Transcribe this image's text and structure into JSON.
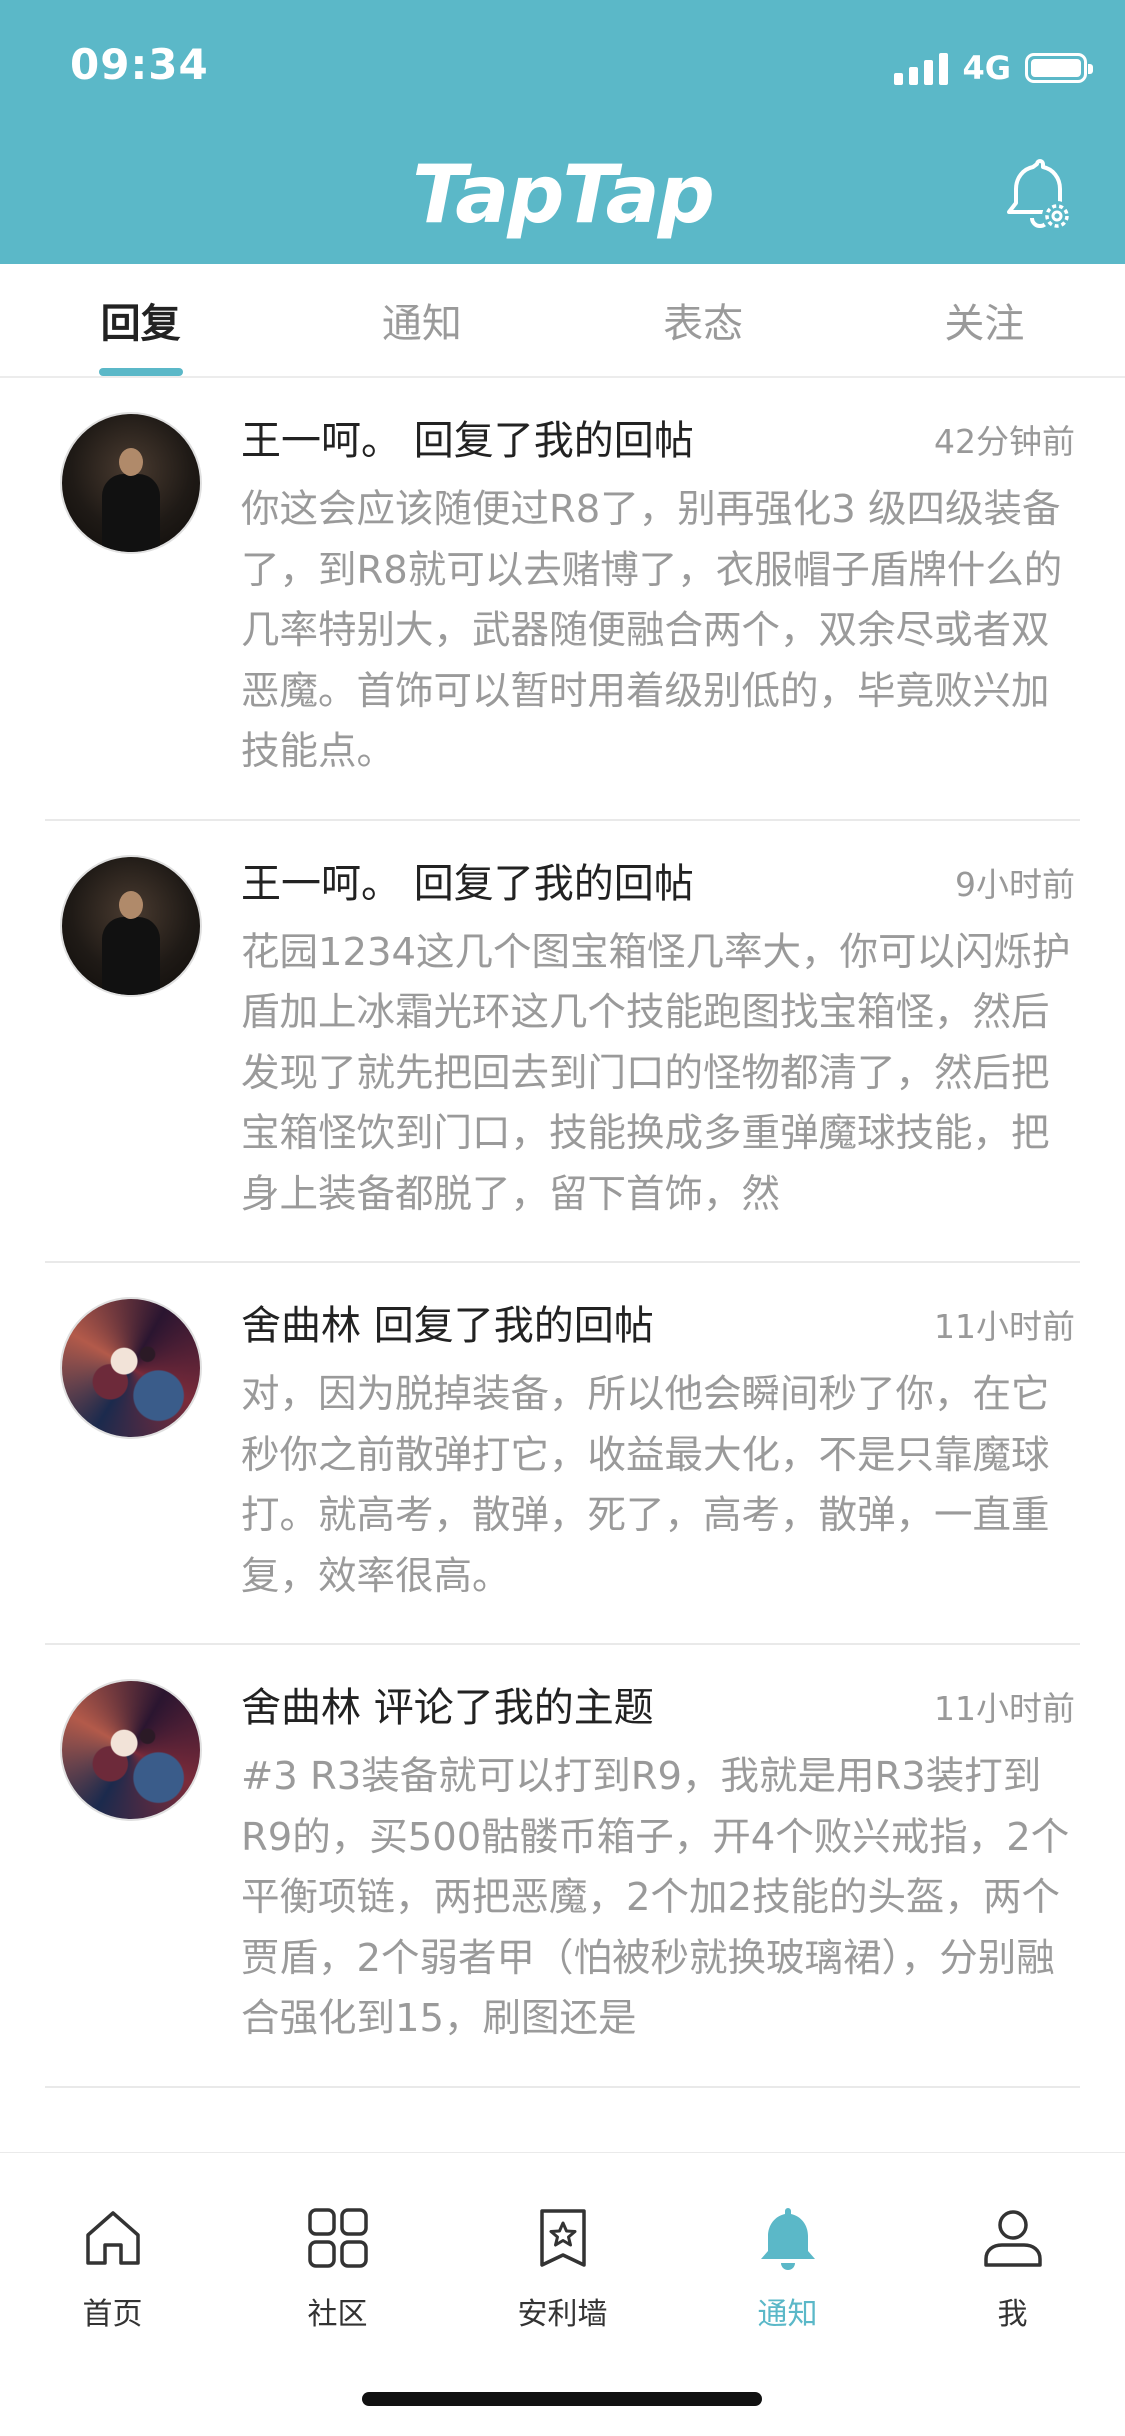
{
  "status_bar": {
    "time": "09:34",
    "network": "4G"
  },
  "header": {
    "app_title": "TapTap",
    "settings_icon": "bell-gear-icon"
  },
  "tabs": [
    {
      "label": "回复",
      "active": true
    },
    {
      "label": "通知",
      "active": false
    },
    {
      "label": "表态",
      "active": false
    },
    {
      "label": "关注",
      "active": false
    }
  ],
  "notifications": [
    {
      "title": "王一呵。 回复了我的回帖",
      "time": "42分钟前",
      "body": "你这会应该随便过R8了，别再强化3 级四级装备了，到R8就可以去赌博了，衣服帽子盾牌什么的几率特别大，武器随便融合两个，双余尽或者双恶魔。首饰可以暂时用着级别低的，毕竟败兴加技能点。"
    },
    {
      "title": "王一呵。 回复了我的回帖",
      "time": "9小时前",
      "body": "花园1234这几个图宝箱怪几率大，你可以闪烁护盾加上冰霜光环这几个技能跑图找宝箱怪，然后发现了就先把回去到门口的怪物都清了，然后把宝箱怪饮到门口，技能换成多重弹魔球技能，把身上装备都脱了，留下首饰，然"
    },
    {
      "title": "舍曲林 回复了我的回帖",
      "time": "11小时前",
      "body": "对，因为脱掉装备，所以他会瞬间秒了你，在它秒你之前散弹打它，收益最大化，不是只靠魔球打。就高考，散弹，死了，高考，散弹，一直重复，效率很高。"
    },
    {
      "title": "舍曲林 评论了我的主题",
      "time": "11小时前",
      "body": "#3 R3装备就可以打到R9，我就是用R3装打到R9的，买500骷髅币箱子，开4个败兴戒指，2个平衡项链，两把恶魔，2个加2技能的头盔，两个贾盾，2个弱者甲（怕被秒就换玻璃裙），分别融合强化到15，刷图还是"
    }
  ],
  "bottom_nav": [
    {
      "label": "首页",
      "icon": "home-icon",
      "active": false
    },
    {
      "label": "社区",
      "icon": "grid-icon",
      "active": false
    },
    {
      "label": "安利墙",
      "icon": "bookmark-star-icon",
      "active": false
    },
    {
      "label": "通知",
      "icon": "bell-icon",
      "active": true
    },
    {
      "label": "我",
      "icon": "user-icon",
      "active": false
    }
  ],
  "colors": {
    "brand": "#5bb8c8",
    "title": "#222222",
    "muted": "#9a9a9a"
  }
}
